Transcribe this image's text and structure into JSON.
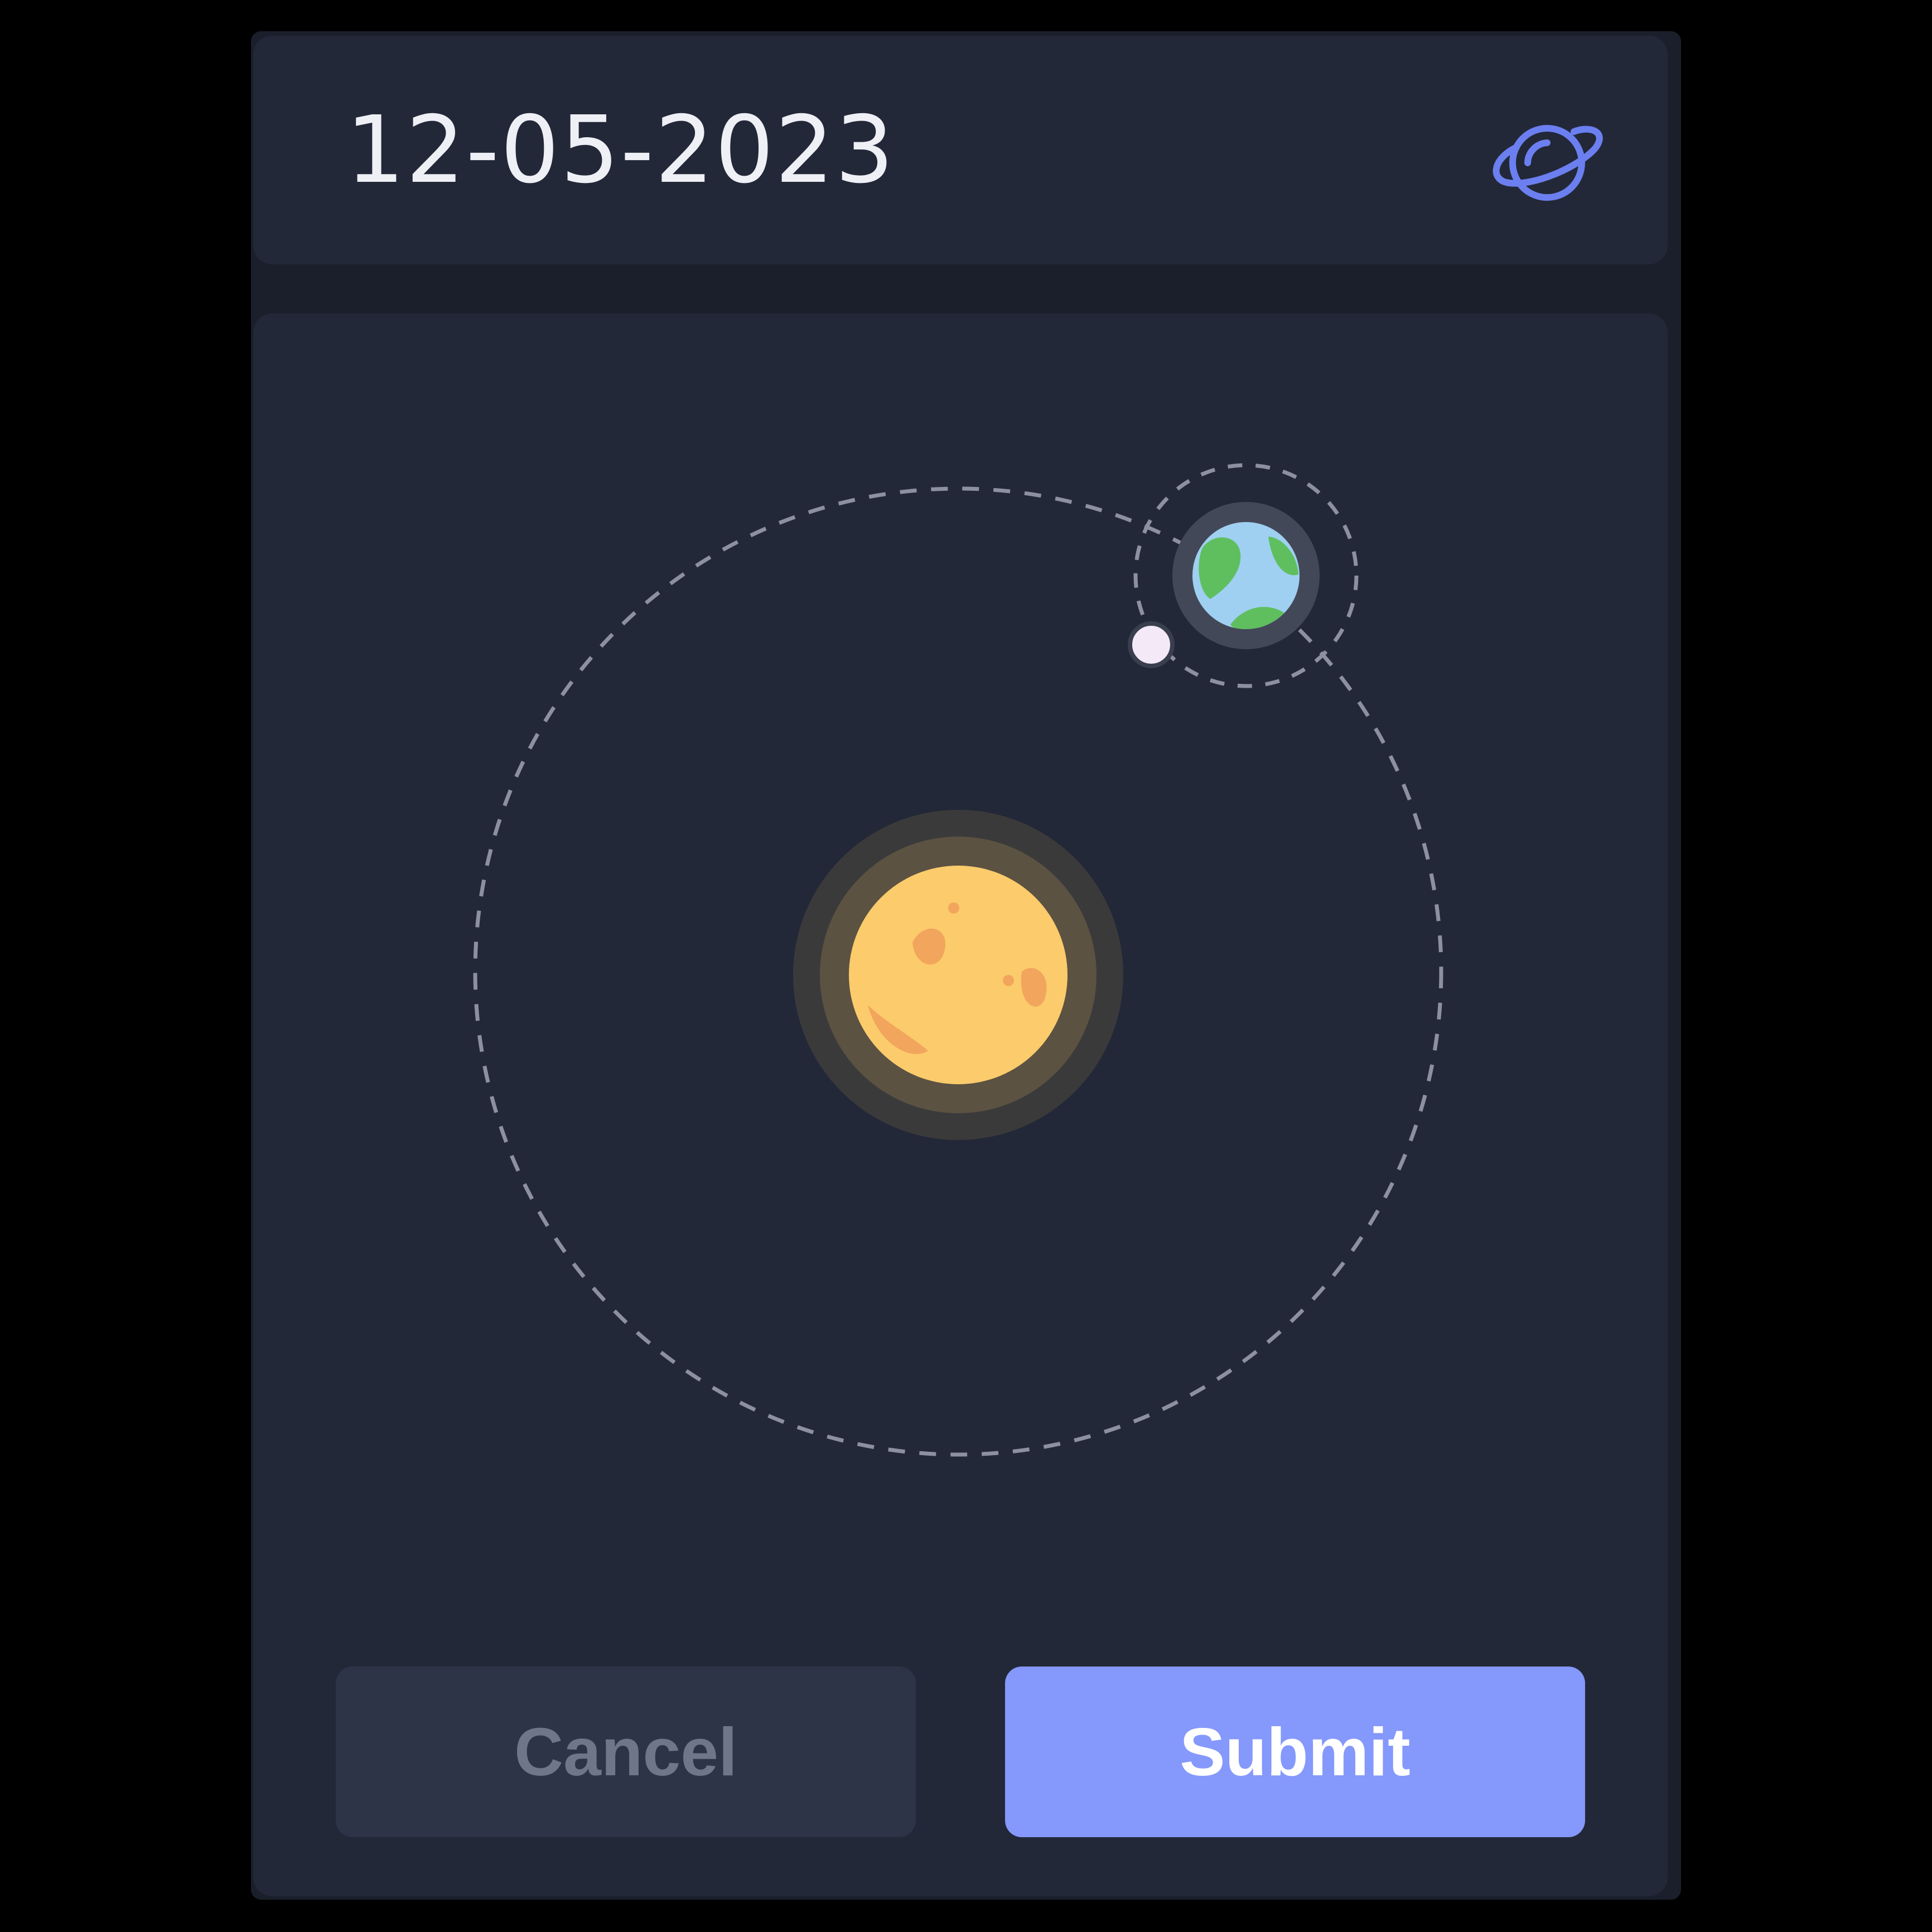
{
  "header": {
    "date": "12-05-2023",
    "icon": "planet-icon"
  },
  "scene": {
    "orbit_style": "dashed",
    "sun_icon": "sun-icon",
    "earth_icon": "earth-icon",
    "moon_icon": "moon-icon"
  },
  "actions": {
    "cancel_label": "Cancel",
    "submit_label": "Submit"
  },
  "colors": {
    "background": "#000000",
    "surface": "#232838",
    "accent": "#8598fb",
    "sun": "#fccb6b",
    "earth_ocean": "#9fd0f2",
    "earth_land": "#5fbf5f",
    "moon": "#f3e9f7"
  }
}
